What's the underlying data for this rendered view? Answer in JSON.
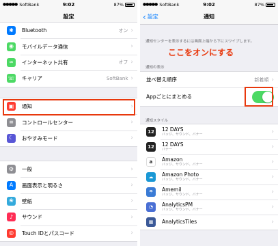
{
  "status": {
    "carrier": "SoftBank",
    "time": "9:02",
    "battery": "87%"
  },
  "left": {
    "title": "設定",
    "group1": [
      {
        "label": "Bluetooth",
        "value": "オン",
        "icon": "bluetooth-icon",
        "color": "#007aff",
        "glyph": "✱"
      },
      {
        "label": "モバイルデータ通信",
        "value": "",
        "icon": "antenna-icon",
        "color": "#4cd964",
        "glyph": "◉"
      },
      {
        "label": "インターネット共有",
        "value": "オフ",
        "icon": "link-icon",
        "color": "#4cd964",
        "glyph": "∞"
      },
      {
        "label": "キャリア",
        "value": "SoftBank",
        "icon": "phone-icon",
        "color": "#4cd964",
        "glyph": "☏"
      }
    ],
    "group2": [
      {
        "label": "通知",
        "value": "",
        "icon": "notification-icon",
        "color": "#ff3b30",
        "glyph": "▣"
      },
      {
        "label": "コントロールセンター",
        "value": "",
        "icon": "control-center-icon",
        "color": "#8e8e93",
        "glyph": "≡"
      },
      {
        "label": "おやすみモード",
        "value": "",
        "icon": "moon-icon",
        "color": "#5856d6",
        "glyph": "☾"
      }
    ],
    "group3": [
      {
        "label": "一般",
        "value": "",
        "icon": "gear-icon",
        "color": "#8e8e93",
        "glyph": "⚙"
      },
      {
        "label": "画面表示と明るさ",
        "value": "",
        "icon": "text-size-icon",
        "color": "#007aff",
        "glyph": "A"
      },
      {
        "label": "壁紙",
        "value": "",
        "icon": "wallpaper-icon",
        "color": "#34aadc",
        "glyph": "❀"
      },
      {
        "label": "サウンド",
        "value": "",
        "icon": "sound-icon",
        "color": "#ff2d55",
        "glyph": "♪"
      },
      {
        "label": "Touch IDとパスコード",
        "value": "",
        "icon": "fingerprint-icon",
        "color": "#ff3b30",
        "glyph": "◎"
      }
    ]
  },
  "right": {
    "title": "通知",
    "back_label": "設定",
    "description": "通知センターを表示するには画面上端から下にスワイプします。",
    "section_view": "通知の表示",
    "sort_label": "並べ替え順序",
    "sort_value": "新着順",
    "group_label": "Appごとにまとめる",
    "callout": "ここをオンにする",
    "section_style": "通知スタイル",
    "apps": [
      {
        "name": "12 DAYS",
        "sub": "バッジ、サウンド、バナー",
        "icon": "twelve-days-icon",
        "color": "#222222",
        "glyph": "12"
      },
      {
        "name": "12 DAYS",
        "sub": "バナー",
        "icon": "twelve-days-icon",
        "color": "#222222",
        "glyph": "12"
      },
      {
        "name": "Amazon",
        "sub": "バッジ、サウンド、バナー",
        "icon": "amazon-icon",
        "color": "#ffffff",
        "glyph": "a"
      },
      {
        "name": "Amazon Photo",
        "sub": "バッジ、サウンド、バナー",
        "icon": "amazon-photo-icon",
        "color": "#1a98d5",
        "glyph": "☁"
      },
      {
        "name": "Amemil",
        "sub": "バッジ、サウンド、バナー",
        "icon": "amemil-icon",
        "color": "#3a7bd5",
        "glyph": "☂"
      },
      {
        "name": "AnalyticsPM",
        "sub": "バッジ、サウンド、バナー",
        "icon": "analytics-icon",
        "color": "#4a6fd4",
        "glyph": "◔"
      },
      {
        "name": "AnalyticsTiles",
        "sub": "",
        "icon": "analytics-tiles-icon",
        "color": "#3b5998",
        "glyph": "▦"
      }
    ]
  }
}
